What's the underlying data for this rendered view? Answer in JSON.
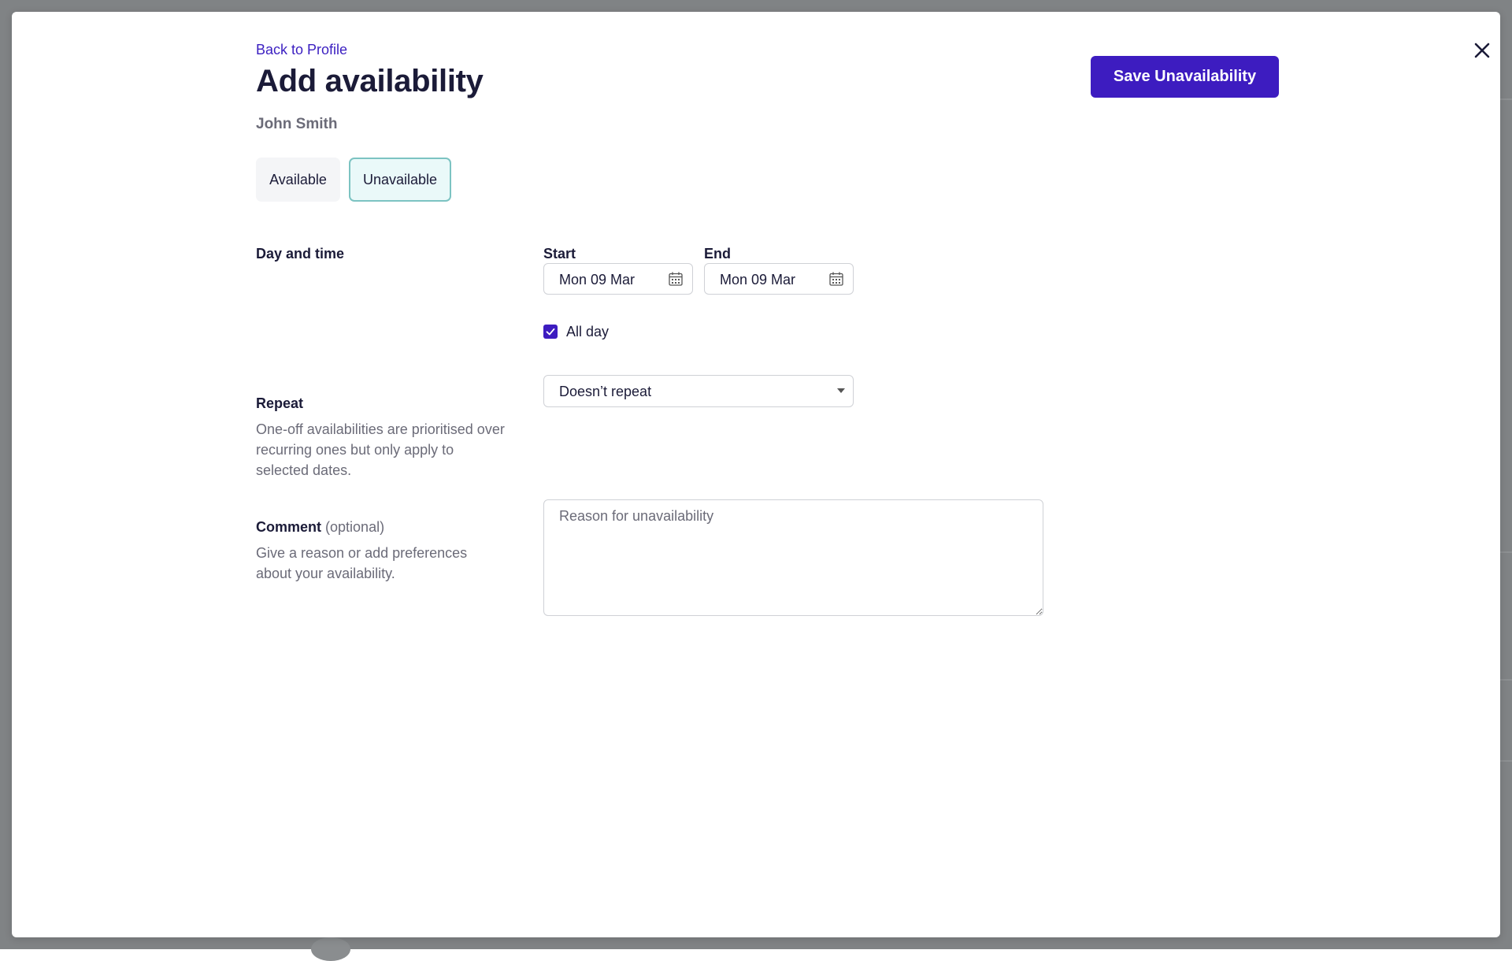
{
  "header": {
    "back_link": "Back to Profile",
    "title": "Add availability",
    "person_name": "John Smith",
    "save_button": "Save Unavailability",
    "close_icon": "close-icon"
  },
  "availability_toggle": {
    "options": [
      "Available",
      "Unavailable"
    ],
    "selected": "Unavailable"
  },
  "day_and_time": {
    "label": "Day and time",
    "start_label": "Start",
    "end_label": "End",
    "start_value": "Mon 09 Mar",
    "end_value": "Mon 09 Mar",
    "calendar_icon": "calendar-icon",
    "all_day_label": "All day",
    "all_day_checked": true
  },
  "repeat": {
    "label": "Repeat",
    "help": "One-off availabilities are prioritised over recurring ones but only apply to selected dates.",
    "selected_value": "Doesn’t repeat"
  },
  "comment": {
    "label": "Comment",
    "optional": "(optional)",
    "help": "Give a reason or add preferences about your availability.",
    "placeholder": "Reason for unavailability",
    "value": ""
  },
  "colors": {
    "accent": "#3d1cc0",
    "selected_toggle_border": "#7cc3c2",
    "selected_toggle_bg": "#eaf9f9",
    "backdrop": "#808385"
  }
}
